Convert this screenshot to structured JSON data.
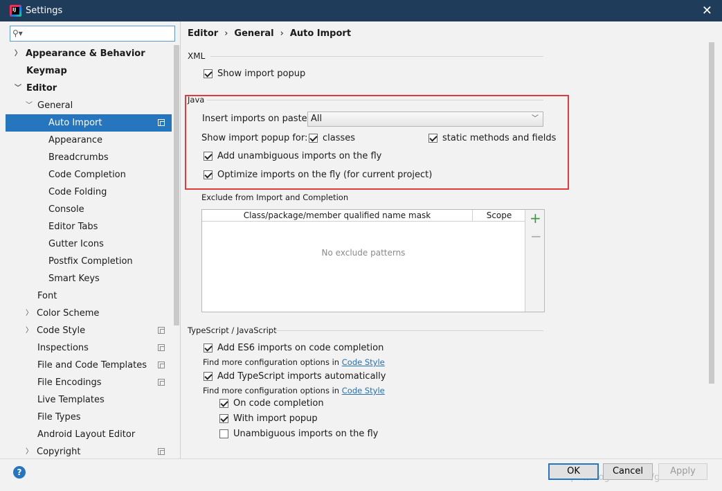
{
  "window": {
    "title": "Settings"
  },
  "search": {
    "placeholder": "",
    "value": ""
  },
  "sidebar": {
    "items": [
      {
        "label": "Appearance & Behavior"
      },
      {
        "label": "Keymap"
      },
      {
        "label": "Editor"
      },
      {
        "label": "General"
      },
      {
        "label": "Auto Import"
      },
      {
        "label": "Appearance"
      },
      {
        "label": "Breadcrumbs"
      },
      {
        "label": "Code Completion"
      },
      {
        "label": "Code Folding"
      },
      {
        "label": "Console"
      },
      {
        "label": "Editor Tabs"
      },
      {
        "label": "Gutter Icons"
      },
      {
        "label": "Postfix Completion"
      },
      {
        "label": "Smart Keys"
      },
      {
        "label": "Font"
      },
      {
        "label": "Color Scheme"
      },
      {
        "label": "Code Style"
      },
      {
        "label": "Inspections"
      },
      {
        "label": "File and Code Templates"
      },
      {
        "label": "File Encodings"
      },
      {
        "label": "Live Templates"
      },
      {
        "label": "File Types"
      },
      {
        "label": "Android Layout Editor"
      },
      {
        "label": "Copyright"
      }
    ]
  },
  "breadcrumb": {
    "part1": "Editor",
    "part2": "General",
    "part3": "Auto Import",
    "sep": "›"
  },
  "xml": {
    "title": "XML",
    "show_import_popup": "Show import popup"
  },
  "java": {
    "title": "Java",
    "insert_label": "Insert imports on paste:",
    "insert_value": "All",
    "popup_for_label": "Show import popup for:",
    "classes": "classes",
    "static_methods": "static methods and fields",
    "add_unambiguous": "Add unambiguous imports on the fly",
    "optimize": "Optimize imports on the fly (for current project)"
  },
  "exclude": {
    "title": "Exclude from Import and Completion",
    "col1": "Class/package/member qualified name mask",
    "col2": "Scope",
    "empty": "No exclude patterns",
    "add": "+",
    "remove": "−"
  },
  "typescript": {
    "title": "TypeScript / JavaScript",
    "es6": "Add ES6 imports on code completion",
    "info1_prefix": "Find more configuration options in ",
    "info1_link": "Code Style",
    "ts_auto": "Add TypeScript imports automatically",
    "info2_prefix": "Find more configuration options in ",
    "info2_link": "Code Style",
    "on_completion": "On code completion",
    "with_popup": "With import popup",
    "unambiguous": "Unambiguous imports on the fly"
  },
  "buttons": {
    "ok": "OK",
    "cancel": "Cancel",
    "apply": "Apply",
    "help": "?"
  },
  "watermark": "https://blog.csdn.net/guoliaosen"
}
